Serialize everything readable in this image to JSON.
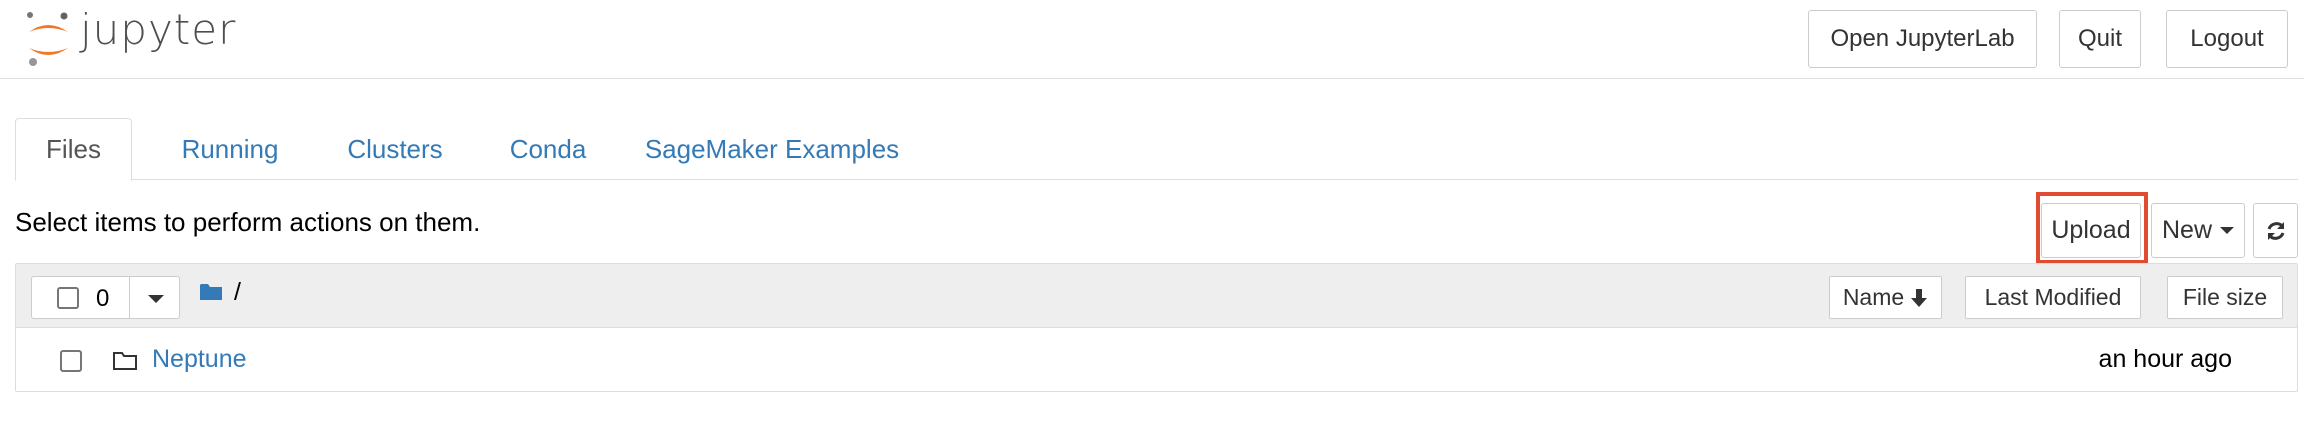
{
  "header": {
    "logo_text": "jupyter",
    "buttons": {
      "open_jupyterlab": "Open JupyterLab",
      "quit": "Quit",
      "logout": "Logout"
    }
  },
  "tabs": [
    "Files",
    "Running",
    "Clusters",
    "Conda",
    "SageMaker Examples"
  ],
  "active_tab": "Files",
  "toolbar": {
    "hint": "Select items to perform actions on them.",
    "upload_label": "Upload",
    "new_label": "New",
    "highlighted": "Upload"
  },
  "list": {
    "selected_count": "0",
    "breadcrumb": "/",
    "columns": {
      "name": "Name",
      "last_modified": "Last Modified",
      "file_size": "File size"
    },
    "items": [
      {
        "name": "Neptune",
        "type": "folder",
        "last_modified": "an hour ago"
      }
    ]
  },
  "icons": {
    "logo": "jupyter-logo-icon",
    "refresh": "refresh-icon",
    "sort": "arrow-down-icon",
    "folder": "folder-icon"
  },
  "colors": {
    "link": "#337ab7",
    "accent": "#f37726",
    "highlight": "#e04c32"
  }
}
